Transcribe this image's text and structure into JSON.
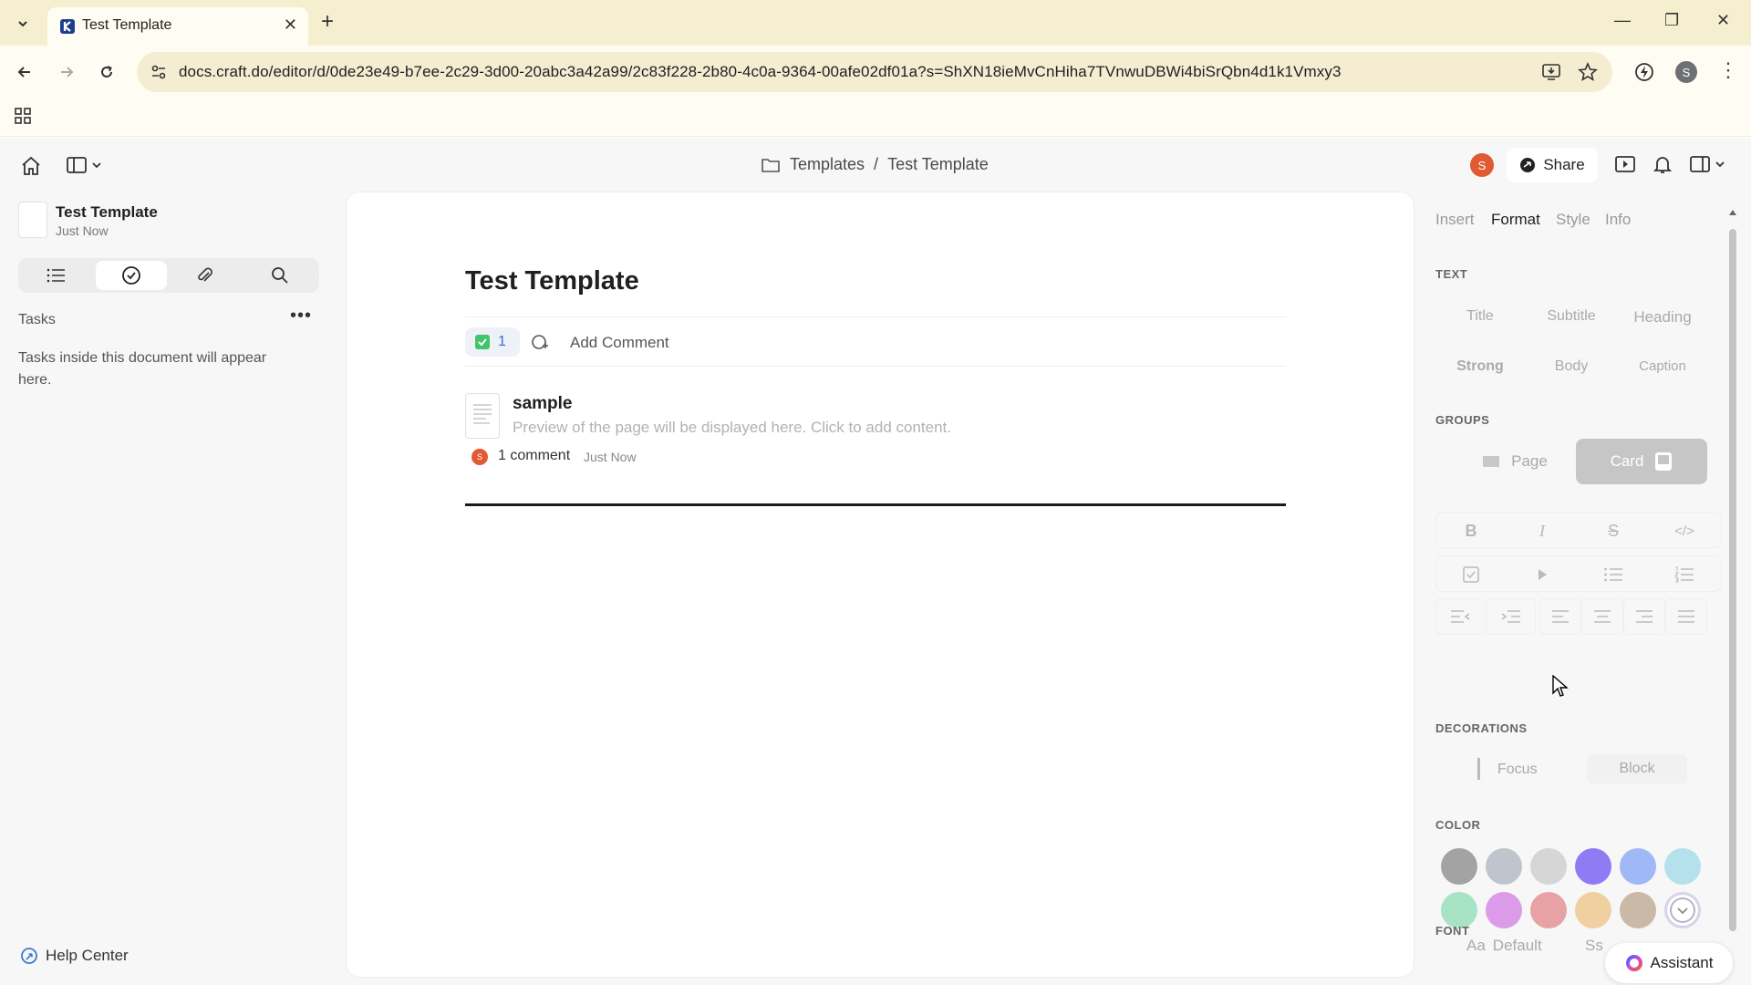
{
  "browser": {
    "tab_title": "Test Template",
    "url": "docs.craft.do/editor/d/0de23e49-b7ee-2c29-3d00-20abc3a42a99/2c83f228-2b80-4c0a-9364-00afe02df01a?s=ShXN18ieMvCnHiha7TVnwuDBWi4biSrQbn4d1k1Vmxy3",
    "profile_initial": "S"
  },
  "header": {
    "breadcrumb_folder": "Templates",
    "breadcrumb_sep": "/",
    "breadcrumb_page": "Test Template",
    "avatar_initial": "S",
    "share_label": "Share"
  },
  "sidebar": {
    "doc_title": "Test Template",
    "doc_subtitle": "Just Now",
    "tasks_label": "Tasks",
    "tasks_more": "•••",
    "tasks_empty": "Tasks inside this document will appear here.",
    "help_label": "Help Center"
  },
  "document": {
    "title": "Test Template",
    "task_count": "1",
    "add_comment": "Add Comment",
    "page_name": "sample",
    "page_preview": "Preview of the page will be displayed here. Click to add content.",
    "comment_avatar": "S",
    "comment_count": "1 comment",
    "comment_time": "Just Now"
  },
  "panel": {
    "tabs": [
      "Insert",
      "Format",
      "Style",
      "Info"
    ],
    "active_tab": "Format",
    "text_section": "TEXT",
    "text_styles": [
      "Title",
      "Subtitle",
      "Heading",
      "Strong",
      "Body",
      "Caption"
    ],
    "groups_section": "GROUPS",
    "group_page": "Page",
    "group_card": "Card",
    "decorations_section": "DECORATIONS",
    "deco_focus": "Focus",
    "deco_block": "Block",
    "color_section": "COLOR",
    "colors": [
      "#a3a3a3",
      "#c0c4cc",
      "#d6d6d6",
      "#8f7cf5",
      "#9eb9f5",
      "#b4e1ec",
      "#a7e3c4",
      "#dc9be8",
      "#e8a1a4",
      "#f0cfa0",
      "#c9b9a6",
      "#ffffff"
    ],
    "font_section": "FONT",
    "font_default": "Default",
    "font_next": "Ss",
    "assistant_label": "Assistant"
  }
}
